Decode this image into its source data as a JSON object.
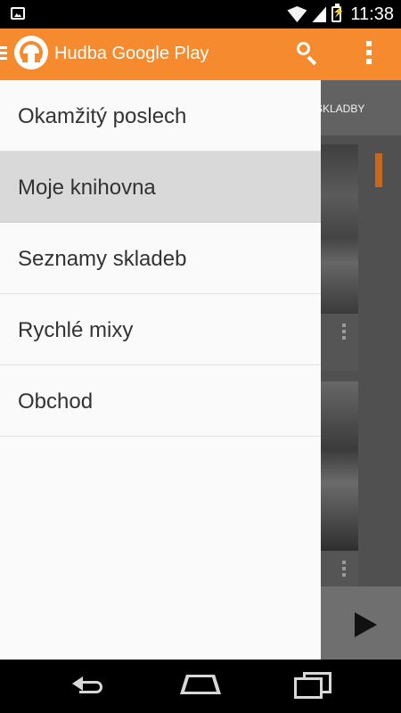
{
  "status_bar": {
    "time": "11:38",
    "left_icon": "image-notification-icon",
    "right_icons": [
      "wifi-icon",
      "signal-icon",
      "battery-charging-icon"
    ]
  },
  "app_bar": {
    "title": "Hudba Google Play",
    "logo_icon": "headphones-icon",
    "actions": [
      "search-icon",
      "more-vert-icon"
    ]
  },
  "background": {
    "tab_partial_label": "SKLADBY",
    "player_action_icon": "play-icon"
  },
  "drawer": {
    "items": [
      {
        "label": "Okamžitý poslech",
        "selected": false
      },
      {
        "label": "Moje knihovna",
        "selected": true
      },
      {
        "label": "Seznamy skladeb",
        "selected": false
      },
      {
        "label": "Rychlé mixy",
        "selected": false
      },
      {
        "label": "Obchod",
        "selected": false
      }
    ]
  },
  "nav_bar": {
    "buttons": [
      "back-icon",
      "home-icon",
      "recents-icon"
    ]
  },
  "colors": {
    "accent": "#f58a2f",
    "drawer_bg": "#fafafa",
    "selected_item_bg": "#d9d9d9",
    "overlay_bg": "#505050"
  }
}
